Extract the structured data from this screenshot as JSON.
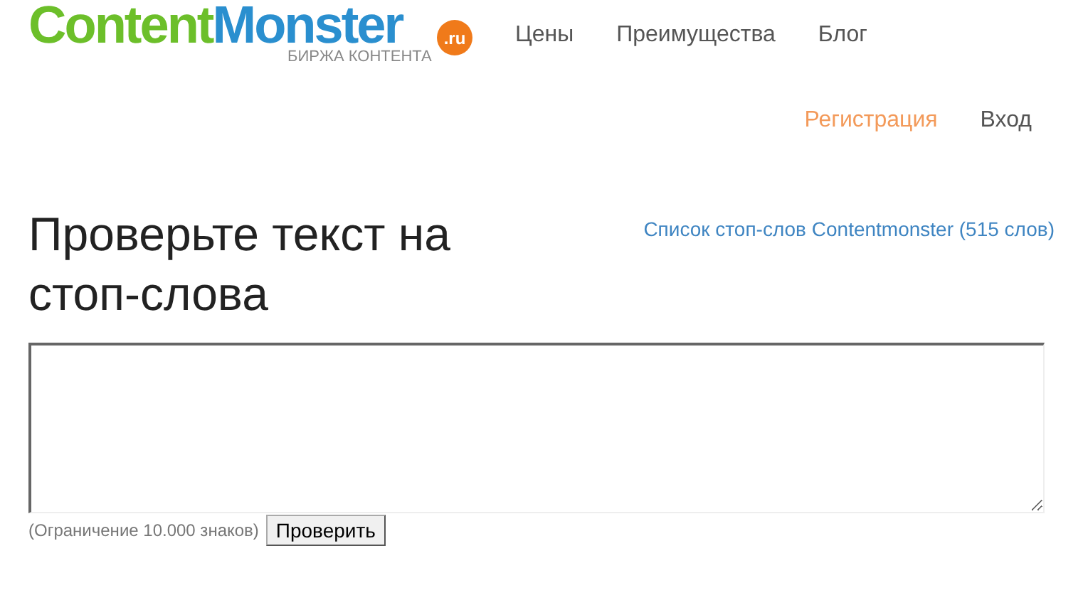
{
  "logo": {
    "word_1": "Content",
    "word_2": "Monster",
    "badge": ".ru",
    "tagline": "БИРЖА КОНТЕНТА"
  },
  "nav": [
    {
      "label": "Цены"
    },
    {
      "label": "Преимущества"
    },
    {
      "label": "Блог"
    }
  ],
  "account": [
    {
      "label": "Регистрация",
      "kind": "highlight"
    },
    {
      "label": "Вход",
      "kind": "plain"
    }
  ],
  "heading": "Проверьте текст на стоп-слова",
  "stopwords_link": "Список стоп-слов Contentmonster (515 слов)",
  "note": "(Ограничение 10.000 знаков)",
  "check_button": "Проверить"
}
